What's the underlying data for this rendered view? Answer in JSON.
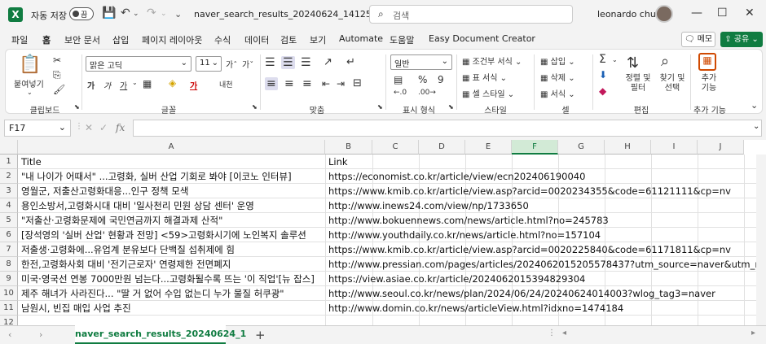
{
  "titlebar": {
    "autosave_label": "자동 저장",
    "autosave_state": "끔",
    "filename": "naver_search_results_20240624_14125...",
    "search_placeholder": "검색",
    "user_name": "leonardo chun"
  },
  "menu": {
    "tabs": [
      "파일",
      "홈",
      "보안 문서",
      "삽입",
      "페이지 레이아웃",
      "수식",
      "데이터",
      "검토",
      "보기",
      "Automate",
      "도움말",
      "Easy Document Creator"
    ],
    "active_tab": "홈",
    "memo_label": "메모",
    "share_label": "공유"
  },
  "ribbon": {
    "clipboard": {
      "paste": "붙여넣기",
      "group": "클립보드"
    },
    "font": {
      "name": "맑은 고딕",
      "size": "11",
      "group": "글꼴",
      "bold": "가",
      "italic": "가",
      "underline": "가",
      "grow": "가ˆ",
      "shrink": "가ˇ",
      "phonetic": "내천"
    },
    "alignment": {
      "group": "맞춤"
    },
    "number": {
      "format": "일반",
      "group": "표시 형식",
      "percent": "%",
      "comma": "9"
    },
    "styles": {
      "conditional": "조건부 서식",
      "table": "표 서식",
      "cell": "셀 스타일",
      "group": "스타일"
    },
    "cells": {
      "insert": "삽입",
      "delete": "삭제",
      "format": "서식",
      "group": "셀"
    },
    "editing": {
      "sort": "정렬 및 필터",
      "find": "찾기 및 선택",
      "group": "편집"
    },
    "addins": {
      "label": "추가 기능",
      "group": "추가 기능"
    }
  },
  "formula_bar": {
    "name_box": "F17",
    "fx": "fx",
    "value": ""
  },
  "grid": {
    "columns": [
      "A",
      "B",
      "C",
      "D",
      "E",
      "F",
      "G",
      "H",
      "I",
      "J"
    ],
    "selected_column": "F",
    "rows": [
      {
        "num": "1",
        "a": "Title",
        "b": "Link"
      },
      {
        "num": "2",
        "a": "\"내 나이가 어때서\" ...고령화, 실버 산업 기회로 봐야 [이코노 인터뷰]",
        "b": "https://economist.co.kr/article/view/ecn202406190040"
      },
      {
        "num": "3",
        "a": "영월군, 저출산고령화대응...인구 정책 모색",
        "b": "https://www.kmib.co.kr/article/view.asp?arcid=0020234355&code=61121111&cp=nv"
      },
      {
        "num": "4",
        "a": "용인소방서,고령화시대 대비 '일사천리 민원 상담 센터' 운영",
        "b": "http://www.inews24.com/view/np/1733650"
      },
      {
        "num": "5",
        "a": "\"저출산·고령화문제에 국민연금까지 해결과제 산적\"",
        "b": "http://www.bokuennews.com/news/article.html?no=245783"
      },
      {
        "num": "6",
        "a": "[장석영의 '실버 산업' 현황과 전망] <59>고령화시기에 노인복지 솔루션",
        "b": "http://www.youthdaily.co.kr/news/article.html?no=157104"
      },
      {
        "num": "7",
        "a": "저출생·고령화에...유업계 분유보다 단백질 섭취제에 힘",
        "b": "https://www.kmib.co.kr/article/view.asp?arcid=0020225840&code=61171811&cp=nv"
      },
      {
        "num": "8",
        "a": "한전,고령화사회 대비 '전기근로자' 연령제한 전면폐지",
        "b": "http://www.pressian.com/pages/articles/2024062015205578437?utm_source=naver&utm_medium=search"
      },
      {
        "num": "9",
        "a": "미국·영국선 연봉 7000만원 넘는다...고령화될수록 뜨는 '이 직업'[뉴 잡스]",
        "b": "https://view.asiae.co.kr/article/2024062015394829304"
      },
      {
        "num": "10",
        "a": "제주 해녀가 사라진다... \"딸 거 없어 수입 없는디 누가 물질 허쿠광\"",
        "b": "http://www.seoul.co.kr/news/plan/2024/06/24/20240624014003?wlog_tag3=naver"
      },
      {
        "num": "11",
        "a": "남원시, 빈집 매입 사업 추진",
        "b": "http://www.domin.co.kr/news/articleView.html?idxno=1474184"
      },
      {
        "num": "12",
        "a": "",
        "b": ""
      }
    ]
  },
  "sheets": {
    "active": "naver_search_results_20240624_1",
    "add": "+"
  },
  "colors": {
    "accent": "#107c41"
  }
}
